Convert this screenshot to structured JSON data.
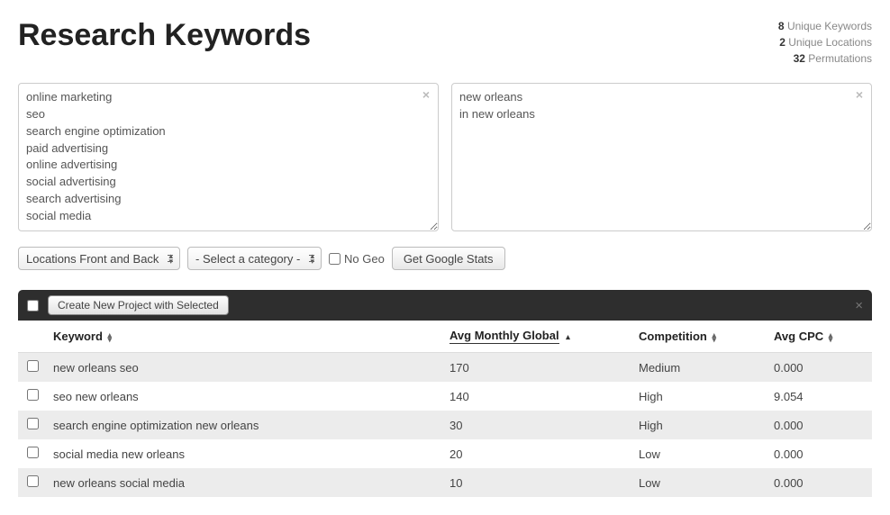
{
  "page_title": "Research Keywords",
  "stats": {
    "keywords_count": "8",
    "keywords_label": " Unique Keywords",
    "locations_count": "2",
    "locations_label": " Unique Locations",
    "permutations_count": "32",
    "permutations_label": " Permutations"
  },
  "keywords_text": "online marketing\nseo\nsearch engine optimization\npaid advertising\nonline advertising\nsocial advertising\nsearch advertising\nsocial media",
  "locations_text": "new orleans\nin new orleans",
  "controls": {
    "location_mode": "Locations Front and Back",
    "category_placeholder": "- Select a category -",
    "no_geo_label": "No Geo",
    "get_stats_label": "Get Google Stats"
  },
  "toolbar": {
    "create_project_label": "Create New Project with Selected"
  },
  "table": {
    "headers": {
      "keyword": "Keyword",
      "avg_monthly": "Avg Monthly Global",
      "competition": "Competition",
      "avg_cpc": "Avg CPC"
    },
    "rows": [
      {
        "keyword": "new orleans seo",
        "avg": "170",
        "competition": "Medium",
        "cpc": "0.000"
      },
      {
        "keyword": "seo new orleans",
        "avg": "140",
        "competition": "High",
        "cpc": "9.054"
      },
      {
        "keyword": "search engine optimization new orleans",
        "avg": "30",
        "competition": "High",
        "cpc": "0.000"
      },
      {
        "keyword": "social media new orleans",
        "avg": "20",
        "competition": "Low",
        "cpc": "0.000"
      },
      {
        "keyword": "new orleans social media",
        "avg": "10",
        "competition": "Low",
        "cpc": "0.000"
      }
    ]
  }
}
